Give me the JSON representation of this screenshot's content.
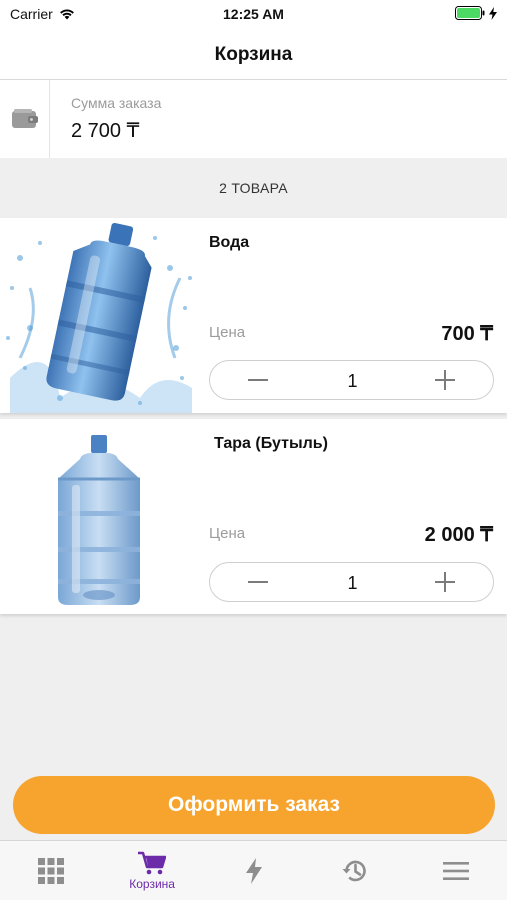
{
  "status_bar": {
    "carrier": "Carrier",
    "time": "12:25 AM"
  },
  "nav": {
    "title": "Корзина"
  },
  "summary": {
    "label": "Сумма заказа",
    "value": "2 700 ₸"
  },
  "items_header": "2 ТОВАРА",
  "items": [
    {
      "name": "Вода",
      "price_label": "Цена",
      "price": "700 ₸",
      "quantity": "1"
    },
    {
      "name": "Тара (Бутыль)",
      "price_label": "Цена",
      "price": "2 000 ₸",
      "quantity": "1"
    }
  ],
  "order_button": "Оформить заказ",
  "tabs": [
    {
      "icon": "grid-icon",
      "label": ""
    },
    {
      "icon": "cart-icon",
      "label": "Корзина",
      "active": true
    },
    {
      "icon": "lightning-icon",
      "label": ""
    },
    {
      "icon": "history-icon",
      "label": ""
    },
    {
      "icon": "menu-icon",
      "label": ""
    }
  ],
  "colors": {
    "accent": "#f7a42e",
    "active_tab": "#6c2ba8",
    "inactive_icon": "#8e8e8e",
    "battery": "#4cd964"
  }
}
